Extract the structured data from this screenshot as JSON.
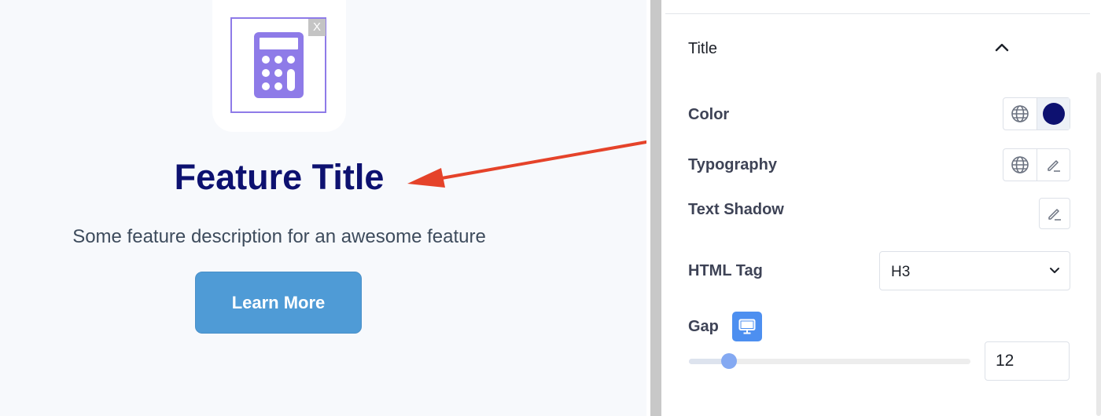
{
  "preview": {
    "remove_label": "X",
    "feature_title": "Feature Title",
    "feature_description": "Some feature description for an awesome feature",
    "button_label": "Learn More",
    "icon": "calculator-icon",
    "title_color": "#0d1170",
    "button_color": "#4f9bd6"
  },
  "annotation": {
    "color": "#e5432a"
  },
  "panel": {
    "section_title": "Title",
    "color_label": "Color",
    "color_value": "#0d1170",
    "typography_label": "Typography",
    "text_shadow_label": "Text Shadow",
    "html_tag_label": "HTML Tag",
    "html_tag_value": "H3",
    "gap_label": "Gap",
    "gap_value": "12",
    "gap_slider_percent": 14,
    "accent": "#4d8ff0"
  }
}
